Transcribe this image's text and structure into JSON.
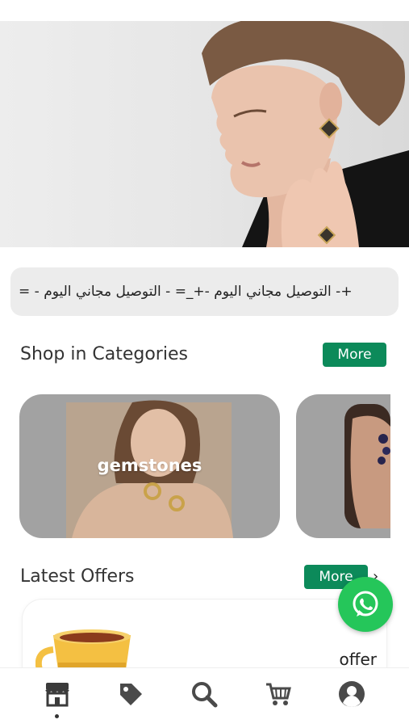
{
  "banner": {
    "marquee_text": "=  - التوصيل مجاني اليوم  -+_=  - التوصيل مجاني اليوم  -+"
  },
  "categories": {
    "title": "Shop in Categories",
    "more_label": "More",
    "items": [
      {
        "label": "gemstones"
      },
      {
        "label": ""
      }
    ]
  },
  "offers": {
    "title": "Latest Offers",
    "more_label": "More",
    "card_label": "offer"
  },
  "nav": {
    "items": [
      {
        "icon": "store-icon",
        "active": true
      },
      {
        "icon": "tag-icon",
        "active": false
      },
      {
        "icon": "search-icon",
        "active": false
      },
      {
        "icon": "cart-icon",
        "active": false
      },
      {
        "icon": "profile-icon",
        "active": false
      }
    ]
  },
  "colors": {
    "accent": "#0c8a5a",
    "whatsapp": "#25c65a",
    "card_gray": "#a2a2a2"
  }
}
